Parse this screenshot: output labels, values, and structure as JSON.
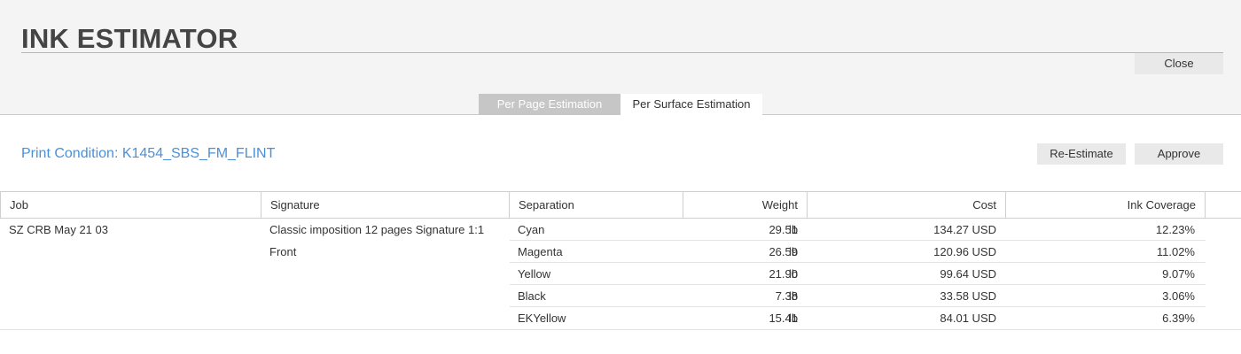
{
  "app": {
    "title": "INK ESTIMATOR",
    "close_label": "Close"
  },
  "tabs": [
    {
      "label": "Per Page Estimation",
      "active": false
    },
    {
      "label": "Per Surface Estimation",
      "active": true
    }
  ],
  "print_condition": "Print Condition: K1454_SBS_FM_FLINT",
  "actions": {
    "reestimate_label": "Re-Estimate",
    "approve_label": "Approve"
  },
  "table": {
    "columns": [
      "Job",
      "Signature",
      "Separation",
      "Weight",
      "Cost",
      "Ink Coverage"
    ],
    "job": "SZ CRB May 21 03",
    "signature": {
      "line1": "Classic imposition 12 pages Signature 1:1",
      "line2": "Front"
    },
    "rows": [
      {
        "separation": "Cyan",
        "weight": "29.51",
        "unit": "lb",
        "cost": "134.27 USD",
        "coverage": "12.23%"
      },
      {
        "separation": "Magenta",
        "weight": "26.59",
        "unit": "lb",
        "cost": "120.96 USD",
        "coverage": "11.02%"
      },
      {
        "separation": "Yellow",
        "weight": "21.90",
        "unit": "lb",
        "cost": "99.64 USD",
        "coverage": "9.07%"
      },
      {
        "separation": "Black",
        "weight": "7.38",
        "unit": "lb",
        "cost": "33.58 USD",
        "coverage": "3.06%"
      },
      {
        "separation": "EKYellow",
        "weight": "15.41",
        "unit": "lb",
        "cost": "84.01 USD",
        "coverage": "6.39%"
      }
    ]
  },
  "colors": {
    "accent": "#4a90d9",
    "header_bg": "#f4f4f4",
    "button_bg": "#e9e9e9",
    "inactive_tab_bg": "#c6c6c6"
  }
}
